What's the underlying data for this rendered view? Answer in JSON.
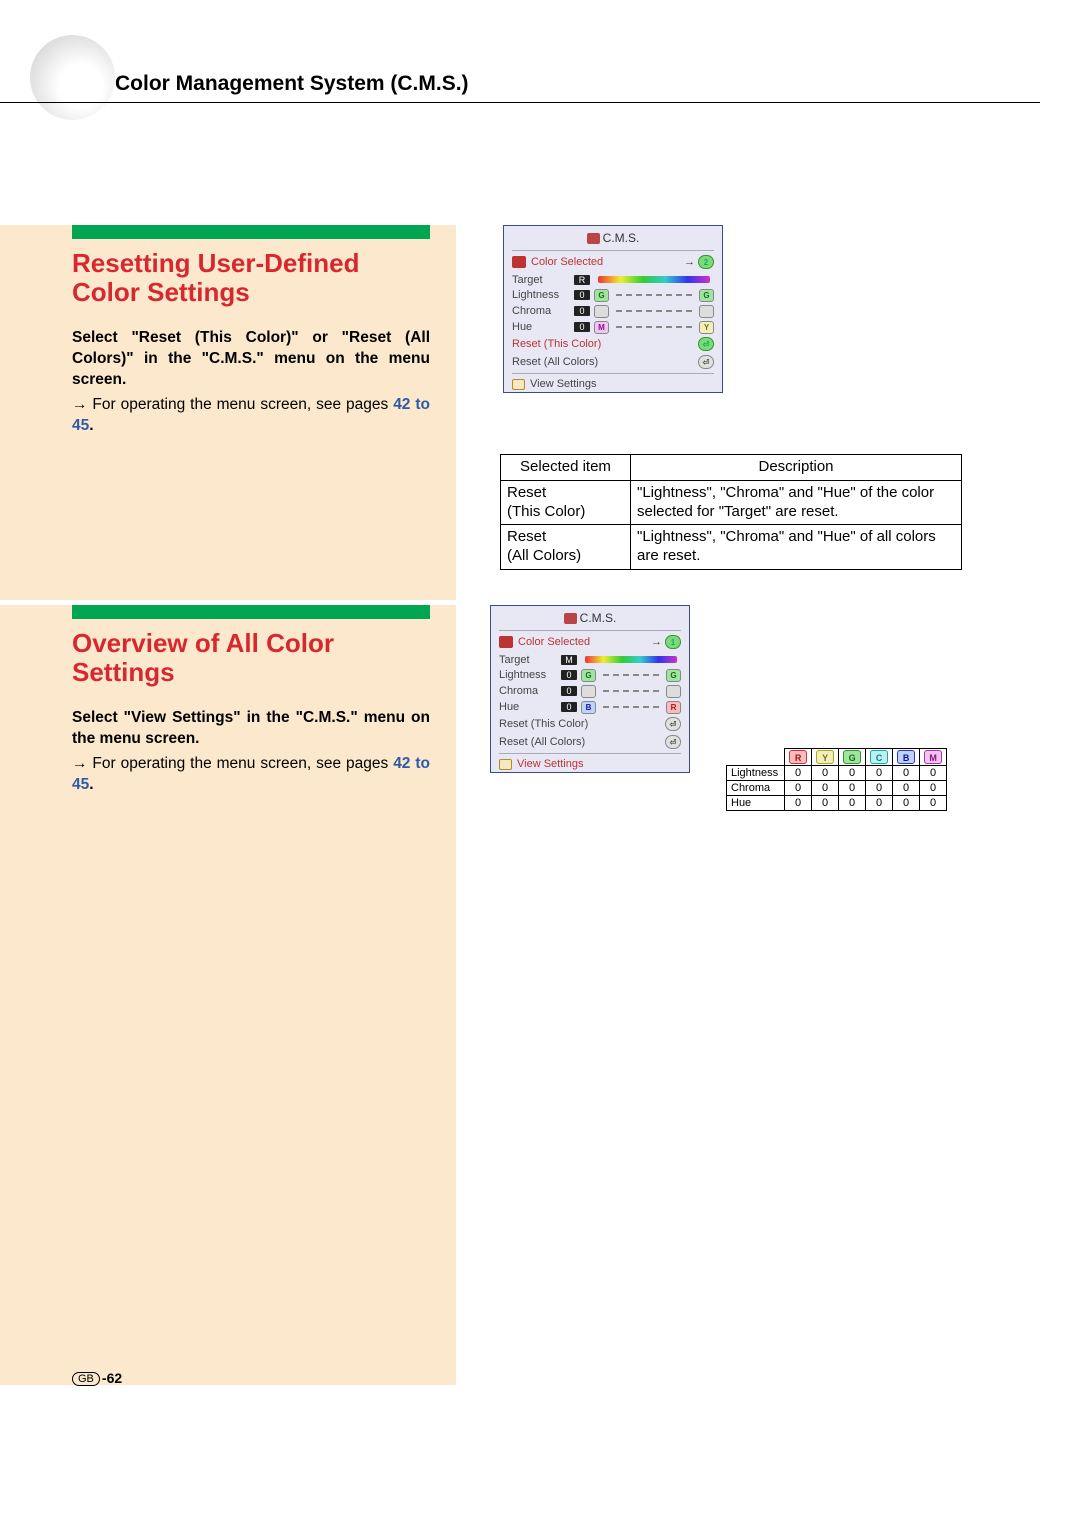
{
  "header": {
    "title": "Color Management System (C.M.S.)"
  },
  "section1": {
    "heading": "Resetting User-Defined Color Settings",
    "body1": "Select \"Reset (This Color)\" or \"Reset (All Colors)\" in the \"C.M.S.\" menu on the menu screen.",
    "body2_prefix": "→ For operating the menu screen, see pages ",
    "body2_ref": "42 to 45",
    "body2_suffix": "."
  },
  "section2": {
    "heading": "Overview of All Color Settings",
    "body1": "Select \"View Settings\" in the \"C.M.S.\" menu on the menu screen.",
    "body2_prefix": "→ For operating the menu screen, see pages ",
    "body2_ref": "42 to 45",
    "body2_suffix": "."
  },
  "cms_menu": {
    "title": "C.M.S.",
    "color_selected": "Color Selected",
    "cs_badge": "2",
    "rows": {
      "target": {
        "label": "Target",
        "val": "R"
      },
      "lightness": {
        "label": "Lightness",
        "val": "0",
        "lChip": "G",
        "rChip": "G",
        "chipClass": "green"
      },
      "chroma": {
        "label": "Chroma",
        "val": "0",
        "lChip": "",
        "rChip": "",
        "chipClass": "grey"
      },
      "hue": {
        "label": "Hue",
        "val": "0",
        "lChip": "M",
        "rChip": "Y",
        "chipClassL": "mag",
        "chipClassR": "yel"
      }
    },
    "reset_this": "Reset (This Color)",
    "reset_all": "Reset (All Colors)",
    "view_settings": "View Settings"
  },
  "cms_menu2": {
    "title": "C.M.S.",
    "color_selected": "Color Selected",
    "cs_badge": "1",
    "rows": {
      "target": {
        "label": "Target",
        "val": "M"
      },
      "lightness": {
        "label": "Lightness",
        "val": "0",
        "lChip": "G",
        "rChip": "G",
        "chipClass": "green"
      },
      "chroma": {
        "label": "Chroma",
        "val": "0",
        "lChip": "",
        "rChip": "",
        "chipClass": "grey"
      },
      "hue": {
        "label": "Hue",
        "val": "0",
        "lChip": "B",
        "rChip": "R",
        "chipClassL": "blue",
        "chipClassR": "red"
      }
    },
    "reset_this": "Reset (This Color)",
    "reset_all": "Reset (All Colors)",
    "view_settings": "View Settings"
  },
  "desc_table": {
    "h1": "Selected item",
    "h2": "Description",
    "rows": [
      {
        "item": "Reset\n(This Color)",
        "desc": "\"Lightness\", \"Chroma\" and \"Hue\" of the color selected for \"Target\" are reset."
      },
      {
        "item": "Reset\n(All Colors)",
        "desc": "\"Lightness\", \"Chroma\" and \"Hue\" of all colors are reset."
      }
    ]
  },
  "vs": {
    "cols": [
      "R",
      "Y",
      "G",
      "C",
      "B",
      "M"
    ],
    "col_classes": [
      "red",
      "yel",
      "green",
      "cyan",
      "blue",
      "mag"
    ],
    "rows": [
      {
        "label": "Lightness",
        "vals": [
          0,
          0,
          0,
          0,
          0,
          0
        ]
      },
      {
        "label": "Chroma",
        "vals": [
          0,
          0,
          0,
          0,
          0,
          0
        ]
      },
      {
        "label": "Hue",
        "vals": [
          0,
          0,
          0,
          0,
          0,
          0
        ]
      }
    ]
  },
  "page_number": {
    "region": "GB",
    "num": "-62"
  }
}
